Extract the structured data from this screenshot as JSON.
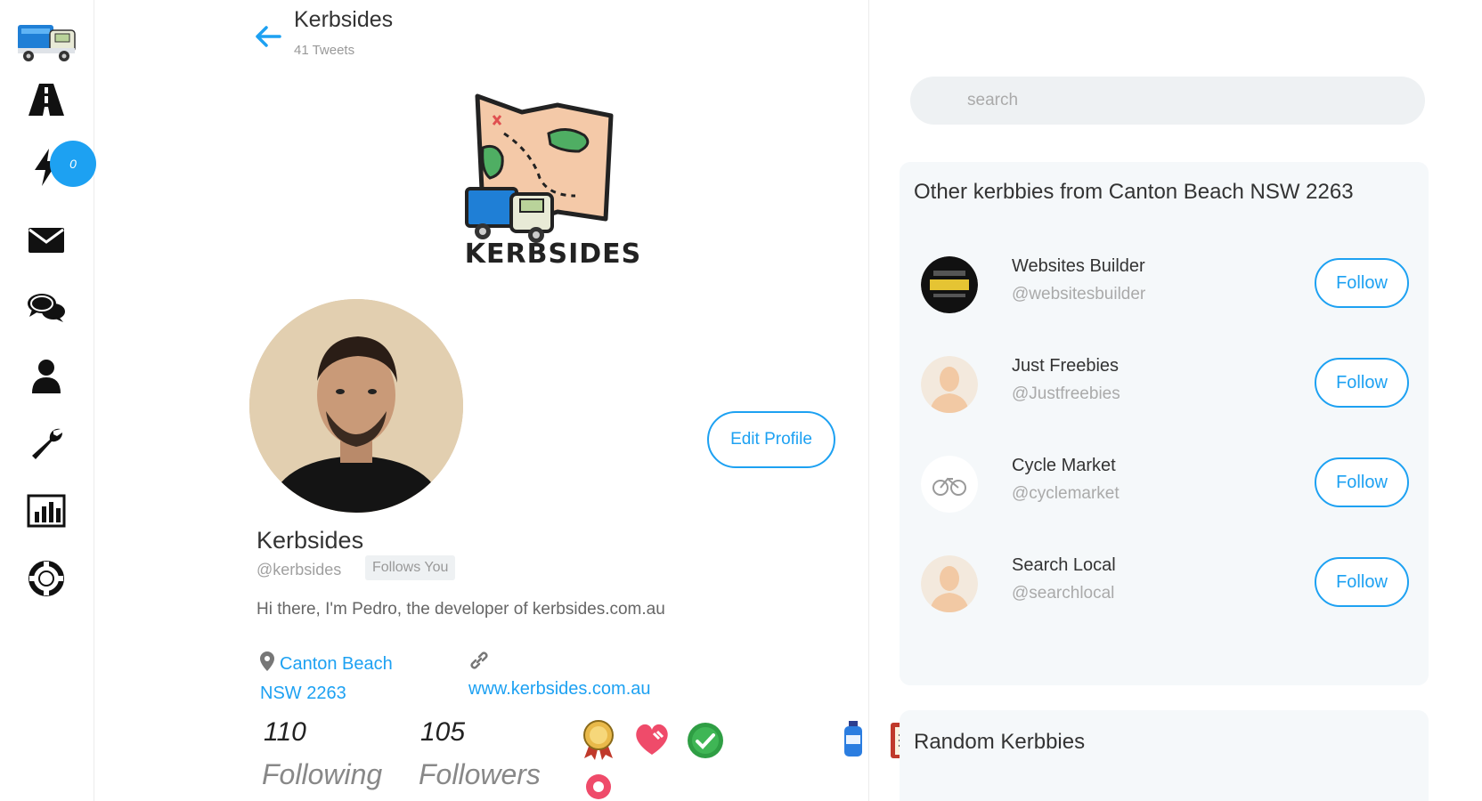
{
  "header": {
    "name": "Kerbsides",
    "tweet_count": "41 Tweets"
  },
  "sidebar": {
    "notification_count": "0",
    "items": [
      {
        "icon": "road-icon"
      },
      {
        "icon": "lightning-icon"
      },
      {
        "icon": "envelope-icon"
      },
      {
        "icon": "chat-bubbles-icon"
      },
      {
        "icon": "user-icon"
      },
      {
        "icon": "wrench-icon"
      },
      {
        "icon": "bar-chart-icon"
      },
      {
        "icon": "lifebuoy-icon"
      }
    ]
  },
  "brand": {
    "logo_text": "KERBSIDES"
  },
  "profile": {
    "name": "Kerbsides",
    "handle": "@kerbsides",
    "follows_you": "Follows You",
    "bio": "Hi there, I'm Pedro, the developer of kerbsides.com.au",
    "location": "Canton Beach NSW 2263",
    "website": "www.kerbsides.com.au",
    "edit_label": "Edit Profile",
    "following_count": "110",
    "following_label": "Following",
    "followers_count": "105",
    "followers_label": "Followers"
  },
  "badges": [
    "award-ribbon-icon",
    "heart-icon",
    "check-circle-icon",
    "water-bottle-icon",
    "clipboard-icon",
    "map-pin-icon"
  ],
  "search": {
    "placeholder": "search"
  },
  "suggestions": {
    "title": "Other kerbbies from Canton Beach NSW 2263",
    "follow_label": "Follow",
    "items": [
      {
        "name": "Websites Builder",
        "handle": "@websitesbuilder"
      },
      {
        "name": "Just Freebies",
        "handle": "@Justfreebies"
      },
      {
        "name": "Cycle Market",
        "handle": "@cyclemarket"
      },
      {
        "name": "Search Local",
        "handle": "@searchlocal"
      }
    ]
  },
  "random": {
    "title": "Random Kerbbies"
  },
  "colors": {
    "accent": "#1da1f2",
    "panel_bg": "#f5f8fa"
  }
}
